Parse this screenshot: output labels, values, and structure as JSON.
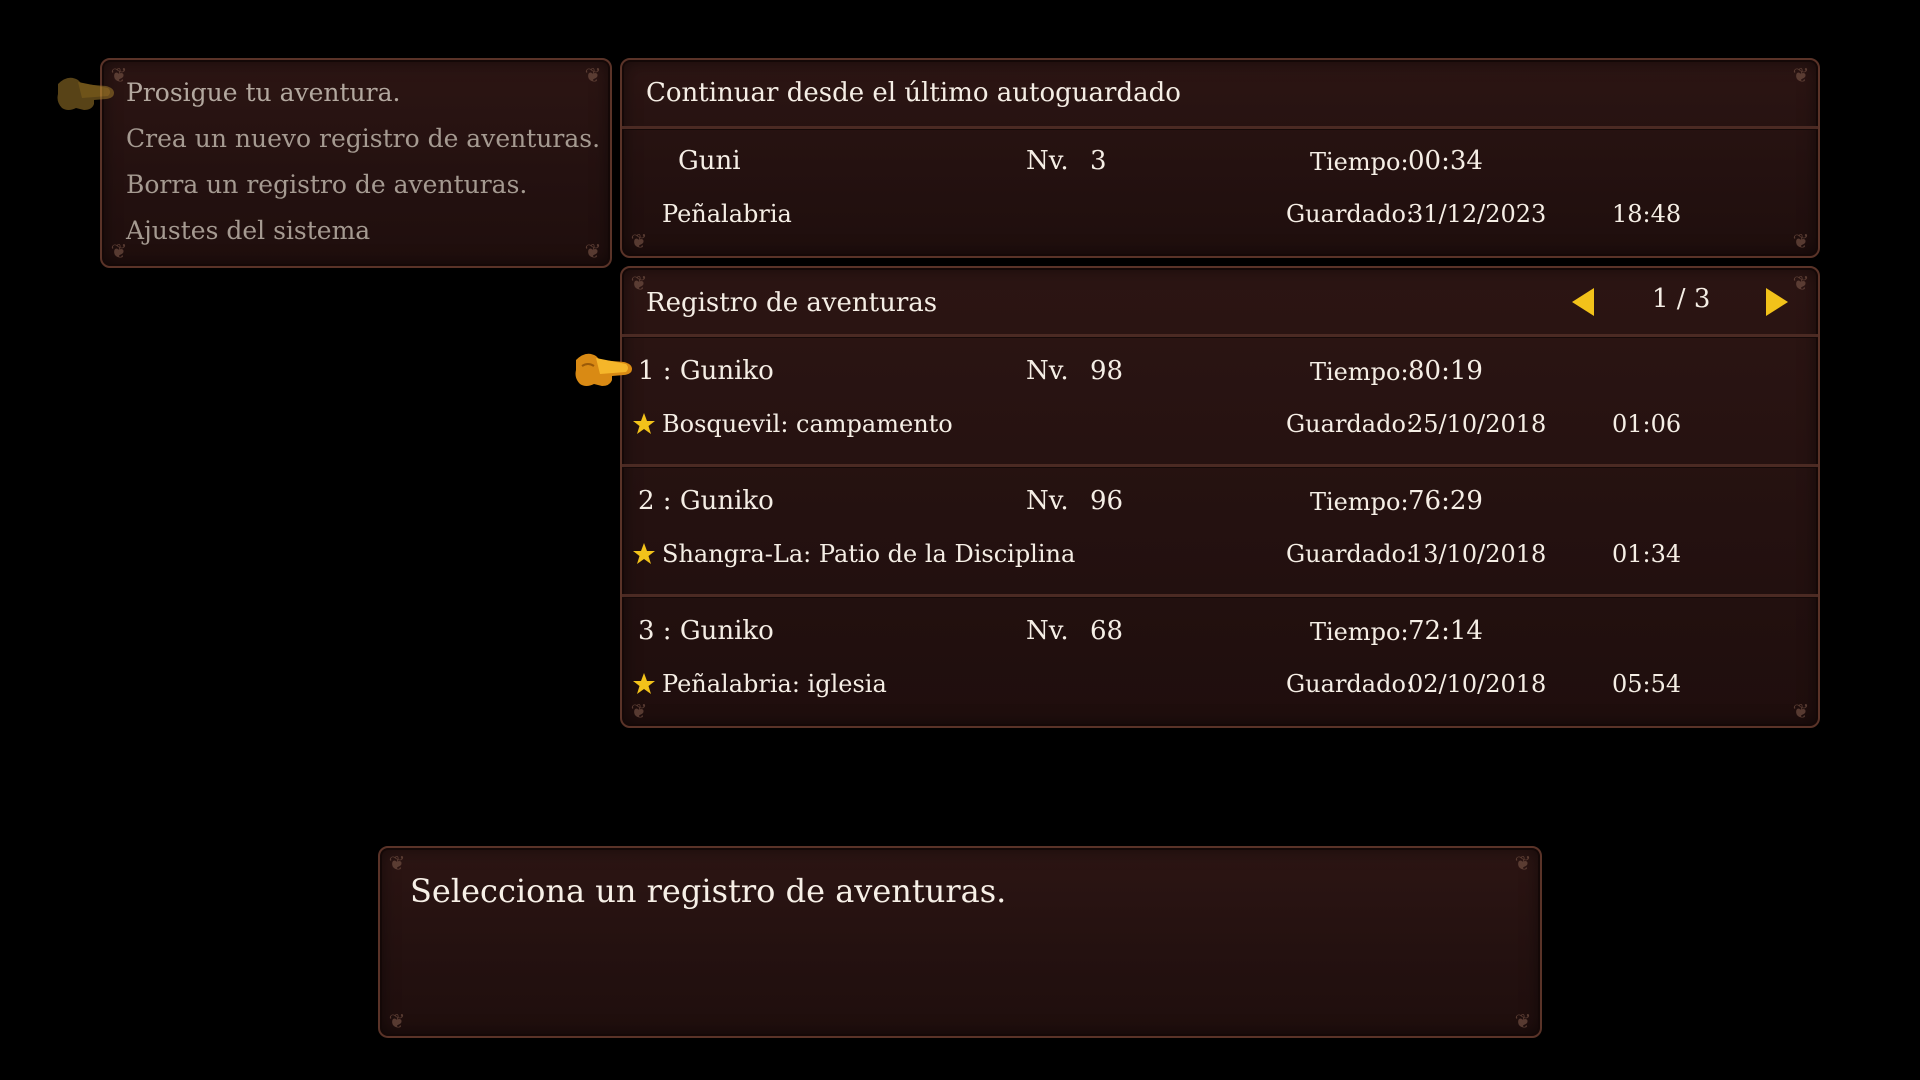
{
  "menu": {
    "items": [
      {
        "label": "Prosigue tu aventura."
      },
      {
        "label": "Crea un nuevo registro de aventuras."
      },
      {
        "label": "Borra un registro de aventuras."
      },
      {
        "label": "Ajustes del sistema"
      }
    ]
  },
  "autosave": {
    "title": "Continuar desde el último autoguardado",
    "name": "Guni",
    "level_label": "Nv.",
    "level": "3",
    "time_label": "Tiempo:",
    "time": "00:34",
    "location": "Peñalabria",
    "saved_label": "Guardado:",
    "saved_date": "31/12/2023",
    "saved_time": "18:48"
  },
  "records": {
    "title": "Registro de aventuras",
    "page": "1 / 3",
    "slots": [
      {
        "name": "1 : Guniko",
        "level_label": "Nv.",
        "level": "98",
        "time_label": "Tiempo:",
        "time": "80:19",
        "location": "Bosquevil: campamento",
        "saved_label": "Guardado:",
        "saved_date": "25/10/2018",
        "saved_time": "01:06"
      },
      {
        "name": "2 : Guniko",
        "level_label": "Nv.",
        "level": "96",
        "time_label": "Tiempo:",
        "time": "76:29",
        "location": "Shangra-La: Patio de la Disciplina",
        "saved_label": "Guardado:",
        "saved_date": "13/10/2018",
        "saved_time": "01:34"
      },
      {
        "name": "3 : Guniko",
        "level_label": "Nv.",
        "level": "68",
        "time_label": "Tiempo:",
        "time": "72:14",
        "location": "Peñalabria: iglesia",
        "saved_label": "Guardado:",
        "saved_date": "02/10/2018",
        "saved_time": "05:54"
      }
    ]
  },
  "message": {
    "text": "Selecciona un registro de aventuras."
  },
  "colors": {
    "panel_bg": "#261211",
    "panel_border": "#5a3328",
    "text": "#f5eee5",
    "menu_text": "#a59a91",
    "accent_gold": "#f2c21a"
  },
  "icons": {
    "cursor": "pointing-hand-icon",
    "star": "star-icon",
    "prev": "arrow-left-icon",
    "next": "arrow-right-icon"
  }
}
